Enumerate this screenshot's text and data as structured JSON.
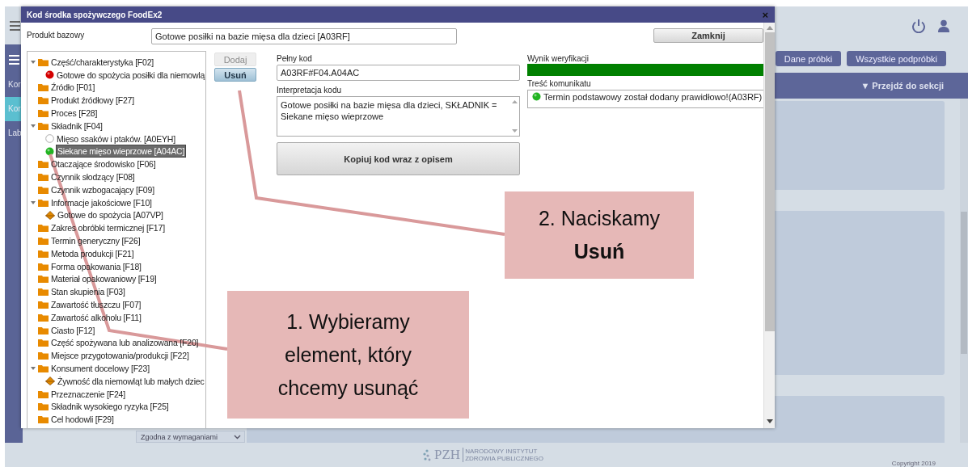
{
  "sidebar": {
    "items": [
      {
        "label": "Kor",
        "selected": false
      },
      {
        "label": "Kor",
        "selected": true
      },
      {
        "label": "Lab",
        "selected": false
      }
    ]
  },
  "content": {
    "buttons": [
      "Dane próbki",
      "Wszystkie podpróbki"
    ],
    "section_menu": "▼ Przejdź do sekcji",
    "status_dropdown": {
      "value": "Zgodna z wymaganiami"
    }
  },
  "footer": {
    "logo_text": "PZH",
    "institute_line_1": "NARODOWY INSTYTUT",
    "institute_line_2": "ZDROWIA PUBLICZNEGO",
    "copyright": "Copyright 2019"
  },
  "dialog": {
    "title": "Kod środka spożywczego FoodEx2",
    "close": "×",
    "base_product": {
      "label": "Produkt bazowy",
      "value": "Gotowe posiłki na bazie mięsa dla dzieci [A03RF]"
    },
    "close_button": "Zamknij",
    "tree": [
      {
        "label": "Część/charakterystyka [F02]",
        "kind": "folder",
        "expanded": true,
        "selected": false,
        "children": [
          {
            "label": "Gotowe do spożycia posiłki dla niemowlą",
            "kind": "dot",
            "color": "#d40000",
            "selected": false
          }
        ]
      },
      {
        "label": "Źródło [F01]",
        "kind": "folder",
        "expanded": false,
        "selected": false
      },
      {
        "label": "Produkt źródłowy [F27]",
        "kind": "folder",
        "expanded": false,
        "selected": false
      },
      {
        "label": "Proces [F28]",
        "kind": "folder",
        "expanded": false,
        "selected": false
      },
      {
        "label": "Składnik [F04]",
        "kind": "folder",
        "expanded": true,
        "selected": false,
        "children": [
          {
            "label": "Mięso ssaków i ptaków. [A0EYH]",
            "kind": "circle",
            "selected": false
          },
          {
            "label": "Siekane mięso wieprzowe [A04AC]",
            "kind": "dot",
            "color": "#22b422",
            "selected": true
          }
        ]
      },
      {
        "label": "Otaczające środowisko [F06]",
        "kind": "folder",
        "expanded": false,
        "selected": false
      },
      {
        "label": "Czynnik słodzący [F08]",
        "kind": "folder",
        "expanded": false,
        "selected": false
      },
      {
        "label": "Czynnik wzbogacający [F09]",
        "kind": "folder",
        "expanded": false,
        "selected": false
      },
      {
        "label": "Informacje jakościowe [F10]",
        "kind": "folder",
        "expanded": true,
        "selected": false,
        "children": [
          {
            "label": "Gotowe do spożycia [A07VP]",
            "kind": "diamond",
            "selected": false
          }
        ]
      },
      {
        "label": "Zakres obróbki termicznej [F17]",
        "kind": "folder",
        "expanded": false,
        "selected": false
      },
      {
        "label": "Termin generyczny [F26]",
        "kind": "folder",
        "expanded": false,
        "selected": false
      },
      {
        "label": "Metoda produkcji [F21]",
        "kind": "folder",
        "expanded": false,
        "selected": false
      },
      {
        "label": "Forma opakowania [F18]",
        "kind": "folder",
        "expanded": false,
        "selected": false
      },
      {
        "label": "Materiał opakowaniowy [F19]",
        "kind": "folder",
        "expanded": false,
        "selected": false
      },
      {
        "label": "Stan skupienia [F03]",
        "kind": "folder",
        "expanded": false,
        "selected": false
      },
      {
        "label": "Zawartość tłuszczu [F07]",
        "kind": "folder",
        "expanded": false,
        "selected": false
      },
      {
        "label": "Zawartość alkoholu [F11]",
        "kind": "folder",
        "expanded": false,
        "selected": false
      },
      {
        "label": "Ciasto [F12]",
        "kind": "folder",
        "expanded": false,
        "selected": false
      },
      {
        "label": "Część spożywana lub analizowana [F20]",
        "kind": "folder",
        "expanded": false,
        "selected": false
      },
      {
        "label": "Miejsce przygotowania/produkcji [F22]",
        "kind": "folder",
        "expanded": false,
        "selected": false
      },
      {
        "label": "Konsument docelowy [F23]",
        "kind": "folder",
        "expanded": true,
        "selected": false,
        "children": [
          {
            "label": "Żywność dla niemowląt lub małych dziec",
            "kind": "diamond",
            "selected": false
          }
        ]
      },
      {
        "label": "Przeznaczenie [F24]",
        "kind": "folder",
        "expanded": false,
        "selected": false
      },
      {
        "label": "Składnik wysokiego ryzyka [F25]",
        "kind": "folder",
        "expanded": false,
        "selected": false
      },
      {
        "label": "Cel hodowli [F29]",
        "kind": "folder",
        "expanded": false,
        "selected": false
      }
    ],
    "actions": [
      {
        "label": "Dodaj",
        "disabled": true
      },
      {
        "label": "Usuń",
        "disabled": false
      }
    ],
    "full_code": {
      "label": "Pełny kod",
      "value": "A03RF#F04.A04AC"
    },
    "interpretation": {
      "label": "Interpretacja kodu",
      "value": "Gotowe posiłki na bazie mięsa dla dzieci, SKŁADNIK = Siekane mięso wieprzowe"
    },
    "copy_button": "Kopiuj kod wraz z opisem",
    "verification": {
      "label": "Wynik weryfikacji",
      "level": 1
    },
    "message": {
      "label": "Treść komunikatu",
      "ok": true,
      "text": "Termin podstawowy został dodany prawidłowo!(A03RF)"
    }
  },
  "callouts": [
    {
      "text": "1. Wybieramy element, który chcemy usunąć"
    },
    {
      "text": "2. Naciskamy **Usuń**"
    }
  ]
}
